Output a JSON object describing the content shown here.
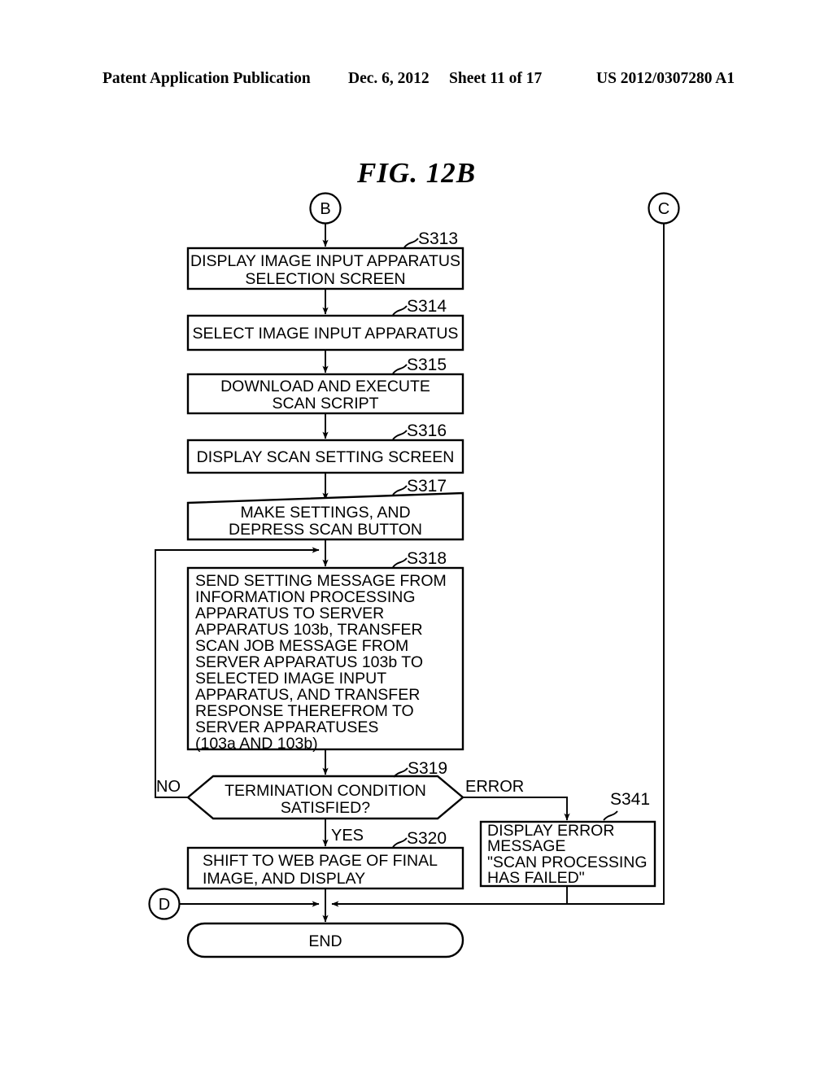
{
  "header": {
    "publication": "Patent Application Publication",
    "date": "Dec. 6, 2012",
    "sheet": "Sheet 11 of 17",
    "patent_number": "US 2012/0307280 A1"
  },
  "figure": {
    "title": "FIG. 12B"
  },
  "connectors": {
    "b": "B",
    "c": "C",
    "d": "D"
  },
  "edge_labels": {
    "no": "NO",
    "yes": "YES",
    "error": "ERROR"
  },
  "steps": {
    "s313": {
      "label": "S313",
      "lines": [
        "DISPLAY IMAGE INPUT APPARATUS",
        "SELECTION SCREEN"
      ]
    },
    "s314": {
      "label": "S314",
      "lines": [
        "SELECT IMAGE INPUT APPARATUS"
      ]
    },
    "s315": {
      "label": "S315",
      "lines": [
        "DOWNLOAD AND EXECUTE",
        "SCAN SCRIPT"
      ]
    },
    "s316": {
      "label": "S316",
      "lines": [
        "DISPLAY SCAN SETTING SCREEN"
      ]
    },
    "s317": {
      "label": "S317",
      "lines": [
        "MAKE SETTINGS, AND",
        "DEPRESS SCAN BUTTON"
      ]
    },
    "s318": {
      "label": "S318",
      "lines": [
        "SEND SETTING MESSAGE FROM",
        "INFORMATION PROCESSING",
        "APPARATUS TO SERVER",
        "APPARATUS 103b, TRANSFER",
        "SCAN JOB MESSAGE FROM",
        "SERVER APPARATUS 103b TO",
        "SELECTED IMAGE INPUT",
        "APPARATUS, AND TRANSFER",
        "RESPONSE THEREFROM TO",
        "SERVER APPARATUSES",
        "(103a AND 103b)"
      ]
    },
    "s319": {
      "label": "S319",
      "lines": [
        "TERMINATION CONDITION",
        "SATISFIED?"
      ]
    },
    "s320": {
      "label": "S320",
      "lines": [
        "SHIFT TO WEB PAGE OF FINAL",
        "IMAGE, AND DISPLAY"
      ]
    },
    "s341": {
      "label": "S341",
      "lines": [
        "DISPLAY ERROR",
        "MESSAGE",
        "\"SCAN PROCESSING",
        " HAS FAILED\""
      ]
    }
  },
  "terminator": {
    "end": "END"
  },
  "colors": {
    "ink": "#000000",
    "paper": "#ffffff"
  }
}
